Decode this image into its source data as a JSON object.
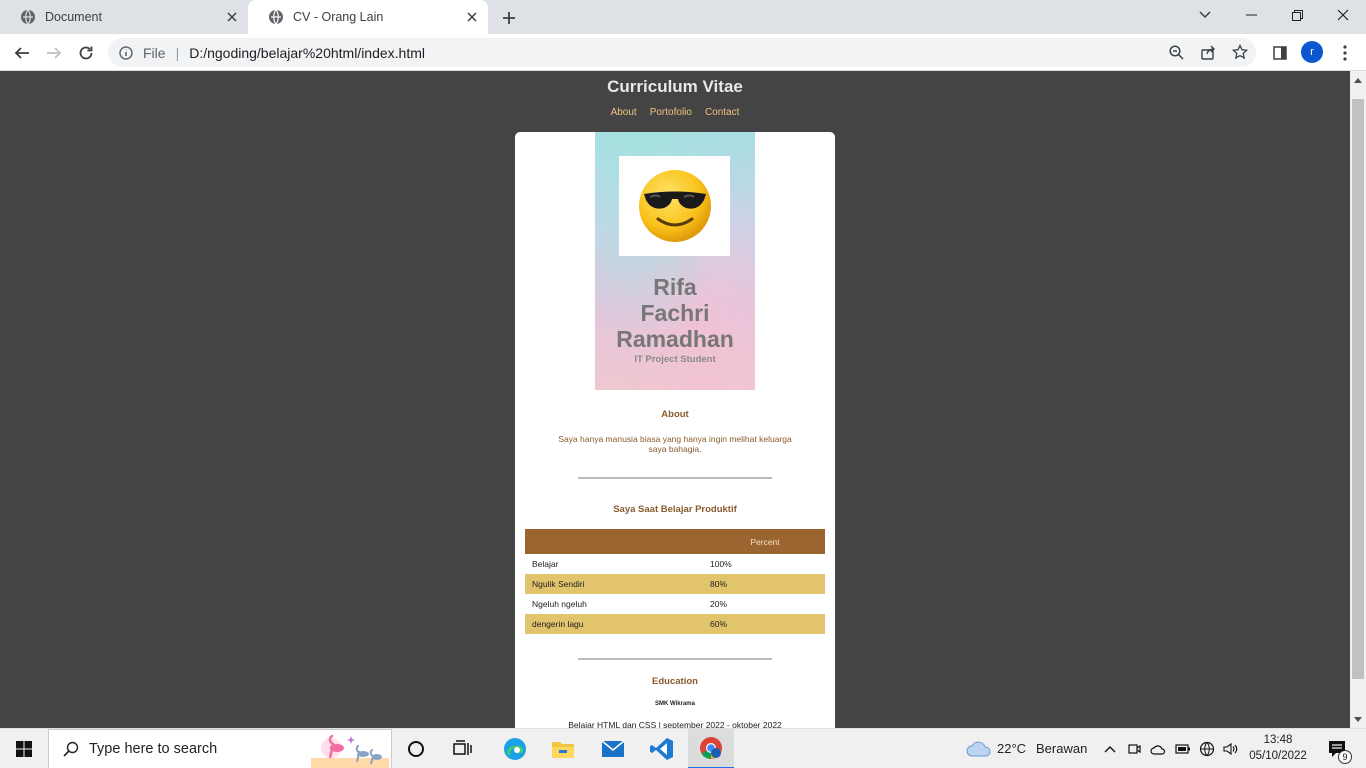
{
  "browser": {
    "tabs": [
      {
        "title": "Document",
        "icon": "globe-icon"
      },
      {
        "title": "CV - Orang Lain",
        "icon": "globe-icon"
      }
    ],
    "address": {
      "security_label": "File",
      "url": "D:/ngoding/belajar%20html/index.html"
    },
    "profile_initial": "r"
  },
  "page": {
    "title": "Curriculum Vitae",
    "nav": [
      "About",
      "Portofolio",
      "Contact"
    ],
    "hero": {
      "name_lines": [
        "Rifa",
        "Fachri",
        "Ramadhan"
      ],
      "subtitle": "IT Project Student"
    },
    "about": {
      "heading": "About",
      "text": "Saya hanya manusia biasa yang hanya ingin melihat keluarga saya bahagia."
    },
    "productive": {
      "heading": "Saya Saat Belajar Produktif",
      "columns": [
        "",
        "Percent"
      ],
      "rows": [
        {
          "activity": "Belajar",
          "percent": "100%"
        },
        {
          "activity": "Ngulik Sendiri",
          "percent": "80%"
        },
        {
          "activity": "Ngeluh ngeluh",
          "percent": "20%"
        },
        {
          "activity": "dengerin lagu",
          "percent": "60%"
        }
      ]
    },
    "education": {
      "heading": "Education",
      "school": "SMK Wikrama",
      "detail": "Belajar HTML dan CSS | september 2022 - oktober 2022"
    }
  },
  "taskbar": {
    "search_placeholder": "Type here to search",
    "weather": {
      "temp": "22°C",
      "condition": "Berawan"
    },
    "time": "13:48",
    "date": "05/10/2022",
    "notification_count": "9"
  },
  "colors": {
    "page_bg": "#444444",
    "accent_brown": "#9b6531",
    "row_gold": "#e2c46c",
    "nav_link": "#f0c080"
  }
}
